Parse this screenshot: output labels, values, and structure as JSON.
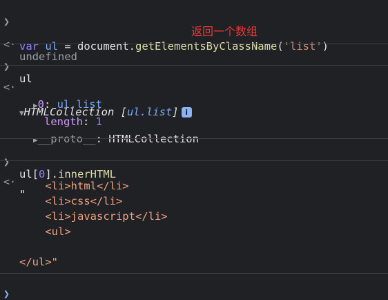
{
  "rows": {
    "r1": {
      "kw": "var",
      "v": "ul",
      "eq": " = document.",
      "fn": "getElementsByClassName",
      "p1": "(",
      "s": "'list'",
      "p2": ")"
    },
    "r2": {
      "text": "undefined"
    },
    "annotation": "返回一个数组",
    "r3": {
      "text": "ul"
    },
    "r4": {
      "type": "HTMLCollection",
      "open": " [",
      "v": "ul.list",
      "close": "]",
      "badge": "i"
    },
    "r5": {
      "k": "0",
      "colon": ": ",
      "v": "ul.list"
    },
    "r6": {
      "k": "length",
      "colon": ": ",
      "v": "1"
    },
    "r7": {
      "k": "__proto__",
      "colon": ": ",
      "v": "HTMLCollection"
    },
    "r8": {
      "a": "ul[",
      "n": "0",
      "b": "].",
      "p": "innerHTML"
    },
    "r9": {
      "text": "\""
    },
    "r10": {
      "text": "    <li>html</li>"
    },
    "r11": {
      "text": "    <li>css</li>"
    },
    "r12": {
      "text": "    <li>javascript</li>"
    },
    "r13": {
      "text": "    <ul>"
    },
    "r14": {
      "text": "</ul>\""
    }
  },
  "icons": {
    "input": "chevron-right-icon",
    "output": "return-arrow-icon",
    "expand": "triangle-right-icon",
    "collapse": "triangle-down-icon",
    "info": "info-badge-icon"
  }
}
